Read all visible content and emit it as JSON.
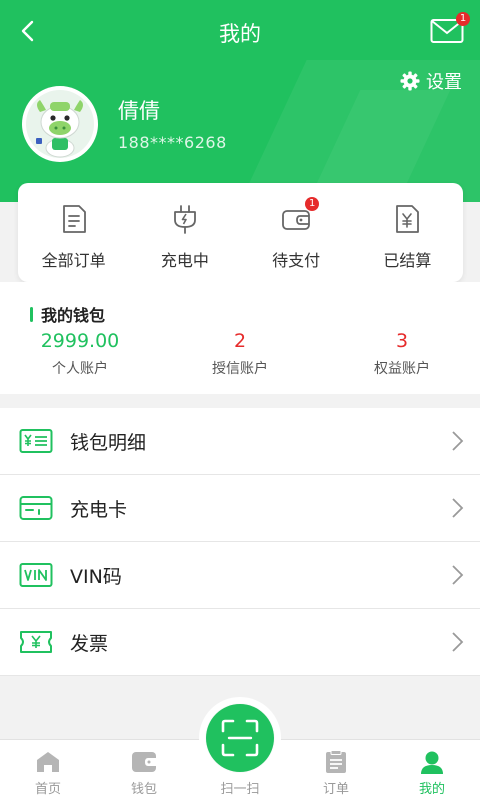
{
  "header": {
    "title": "我的",
    "mail_badge": "1",
    "settings_label": "设置"
  },
  "user": {
    "name": "倩倩",
    "phone": "188****6268"
  },
  "orders": [
    {
      "label": "全部订单",
      "icon": "document-icon"
    },
    {
      "label": "充电中",
      "icon": "plug-icon"
    },
    {
      "label": "待支付",
      "icon": "wallet-icon",
      "badge": "1"
    },
    {
      "label": "已结算",
      "icon": "yen-receipt-icon"
    }
  ],
  "wallet": {
    "title": "我的钱包",
    "accounts": [
      {
        "value": "2999.00",
        "label": "个人账户",
        "color": "#20c15f"
      },
      {
        "value": "2",
        "label": "授信账户",
        "color": "#e62b2b"
      },
      {
        "value": "3",
        "label": "权益账户",
        "color": "#e62b2b"
      }
    ]
  },
  "menu": [
    {
      "label": "钱包明细",
      "icon": "wallet-detail-icon"
    },
    {
      "label": "充电卡",
      "icon": "card-icon"
    },
    {
      "label": "VIN码",
      "icon": "vin-icon"
    },
    {
      "label": "发票",
      "icon": "invoice-icon"
    }
  ],
  "tabs": [
    {
      "label": "首页",
      "icon": "home-icon",
      "active": false
    },
    {
      "label": "钱包",
      "icon": "wallet-icon",
      "active": false
    },
    {
      "label": "扫一扫",
      "icon": "scan-icon",
      "active": false
    },
    {
      "label": "订单",
      "icon": "order-icon",
      "active": false
    },
    {
      "label": "我的",
      "icon": "user-icon",
      "active": true
    }
  ],
  "colors": {
    "brand": "#20c15f",
    "badge": "#e62b2b"
  }
}
